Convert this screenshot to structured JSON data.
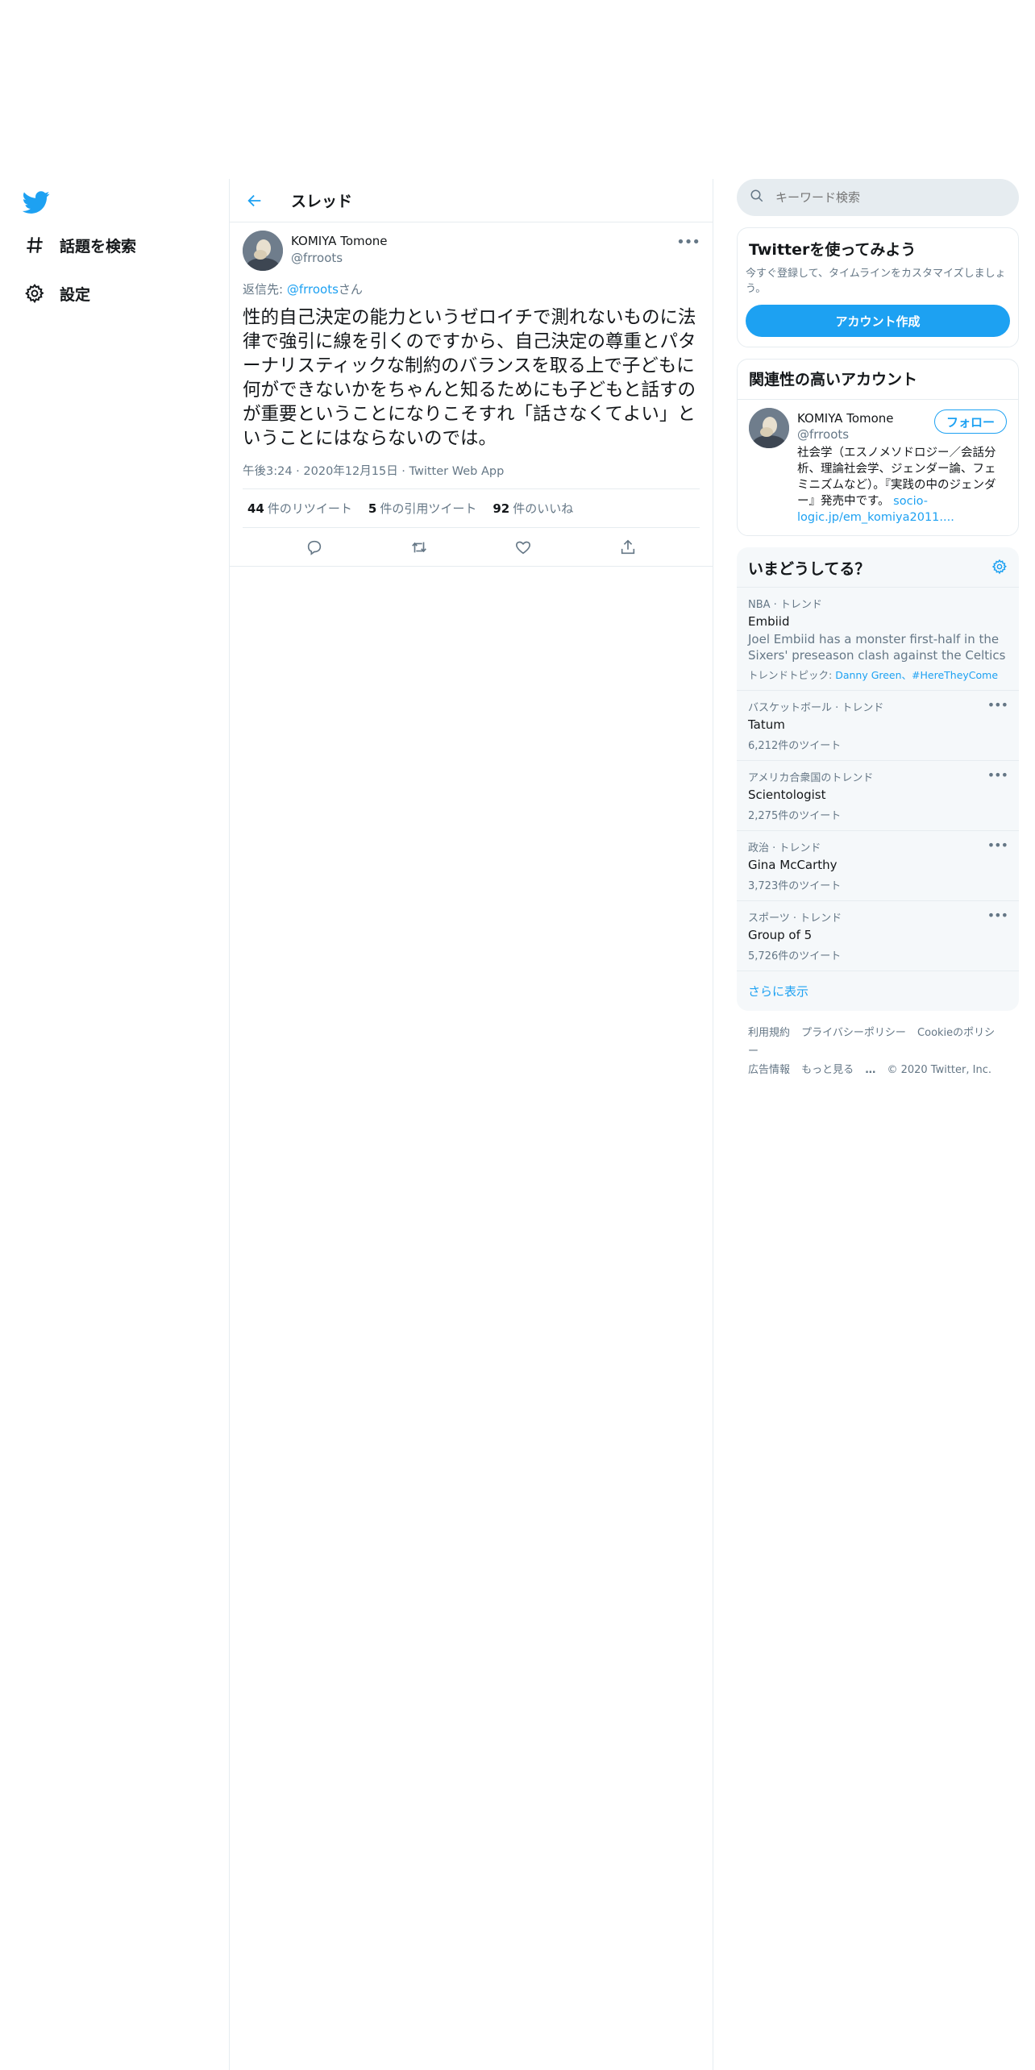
{
  "nav": {
    "items": [
      {
        "label": "話題を検索",
        "icon": "hashtag-icon"
      },
      {
        "label": "設定",
        "icon": "gear-icon"
      }
    ]
  },
  "header": {
    "title": "スレッド"
  },
  "tweet": {
    "author_name": "KOMIYA Tomone",
    "author_handle": "@frroots",
    "reply_prefix": "返信先: ",
    "reply_handle": "@frroots",
    "reply_suffix": "さん",
    "text": "性的自己決定の能力というゼロイチで測れないものに法律で強引に線を引くのですから、自己決定の尊重とパターナリスティックな制約のバランスを取る上で子どもに何ができないかをちゃんと知るためにも子どもと話すのが重要ということになりこそすれ「話さなくてよい」ということにはならないのでは。",
    "meta": "午後3:24 · 2020年12月15日 · Twitter Web App",
    "stats": {
      "retweets_count": "44",
      "retweets_label": "件のリツイート",
      "quotes_count": "5",
      "quotes_label": "件の引用ツイート",
      "likes_count": "92",
      "likes_label": "件のいいね"
    }
  },
  "search": {
    "placeholder": "キーワード検索"
  },
  "signup": {
    "title": "Twitterを使ってみよう",
    "desc": "今すぐ登録して、タイムラインをカスタマイズしましょう。",
    "button": "アカウント作成"
  },
  "related": {
    "title": "関連性の高いアカウント",
    "name": "KOMIYA Tomone",
    "handle": "@frroots",
    "follow": "フォロー",
    "bio": "社会学（エスノメソドロジー／会話分析、理論社会学、ジェンダー論、フェミニズムなど）。『実践の中のジェンダー』発売中です。",
    "bio_link": "socio-logic.jp/em_komiya2011...."
  },
  "trends": {
    "title": "いまどうしてる？",
    "items": [
      {
        "context": "NBA · トレンド",
        "name": "Embiid",
        "desc": "Joel Embiid has a monster first-half in the Sixers' preseason clash against the Celtics",
        "topics_label": "トレンドトピック: ",
        "topics": "Danny Green、#HereTheyCome"
      },
      {
        "context": "バスケットボール · トレンド",
        "name": "Tatum",
        "count": "6,212件のツイート"
      },
      {
        "context": "アメリカ合衆国のトレンド",
        "name": "Scientologist",
        "count": "2,275件のツイート"
      },
      {
        "context": "政治 · トレンド",
        "name": "Gina McCarthy",
        "count": "3,723件のツイート"
      },
      {
        "context": "スポーツ · トレンド",
        "name": "Group of 5",
        "count": "5,726件のツイート"
      }
    ],
    "show_more": "さらに表示"
  },
  "footer": {
    "terms": "利用規約",
    "privacy": "プライバシーポリシー",
    "cookie": "Cookieのポリシー",
    "ads": "広告情報",
    "more": "もっと見る",
    "copyright": "© 2020 Twitter, Inc."
  },
  "colors": {
    "accent": "#1da1f2",
    "muted": "#657786",
    "border": "#e6ecf0"
  }
}
